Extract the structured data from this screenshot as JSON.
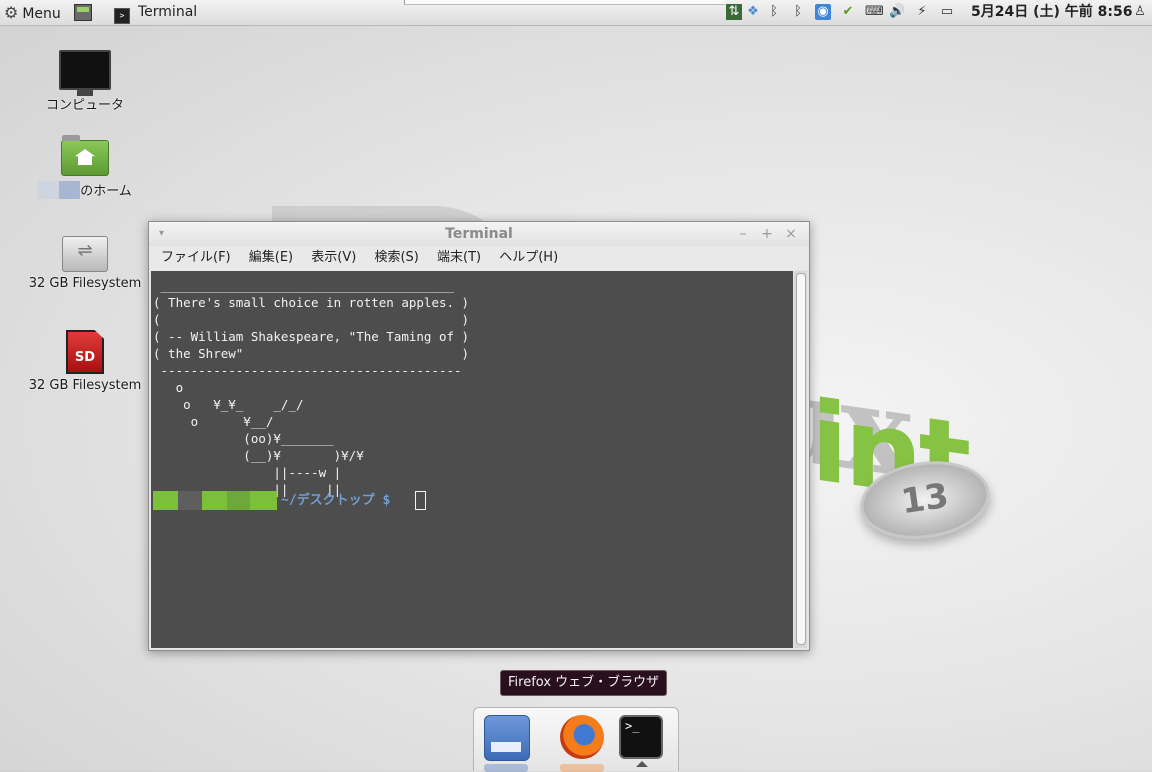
{
  "top_panel": {
    "menu_label": "Menu",
    "task_label": "Terminal",
    "clock": "5月24日 (土) 午前 8:56",
    "tray_icons": [
      "network-manager-icon",
      "dropbox-icon",
      "bluetooth-icon",
      "bluetooth-icon",
      "wifi-icon",
      "update-manager-icon",
      "keyboard-icon",
      "volume-icon",
      "power-plug-icon",
      "battery-icon",
      "user-icon"
    ]
  },
  "desktop": {
    "icons": [
      {
        "name": "computer",
        "label": "コンピュータ"
      },
      {
        "name": "home",
        "label": "のホーム"
      },
      {
        "name": "usb-drive",
        "label": "32 GB Filesystem"
      },
      {
        "name": "sd-card",
        "label": "32 GB Filesystem",
        "badge": "SD"
      }
    ]
  },
  "terminal": {
    "title": "Terminal",
    "menus": [
      "ファイル(F)",
      "編集(E)",
      "表示(V)",
      "検索(S)",
      "端末(T)",
      "ヘルプ(H)"
    ],
    "output": " _______________________________________\n( There's small choice in rotten apples. )\n(                                        )\n( -- William Shakespeare, \"The Taming of )\n( the Shrew\"                             )\n ----------------------------------------\n   o\n    o   ¥_¥_    _/_/\n     o      ¥__/\n            (oo)¥_______\n            (__)¥       )¥/¥\n                ||----w |\n                ||     ||",
    "prompt": "~/デスクトップ $"
  },
  "tooltip": "Firefox ウェブ・ブラウザ",
  "dock": {
    "items": [
      "show-desktop",
      "firefox",
      "terminal"
    ],
    "terminal_glyph": ">_"
  },
  "colors": {
    "accent_green": "#86c244",
    "prompt_blue": "#729fcf",
    "terminal_bg": "#4d4d4d",
    "tooltip_bg": "#2a0f1f"
  }
}
